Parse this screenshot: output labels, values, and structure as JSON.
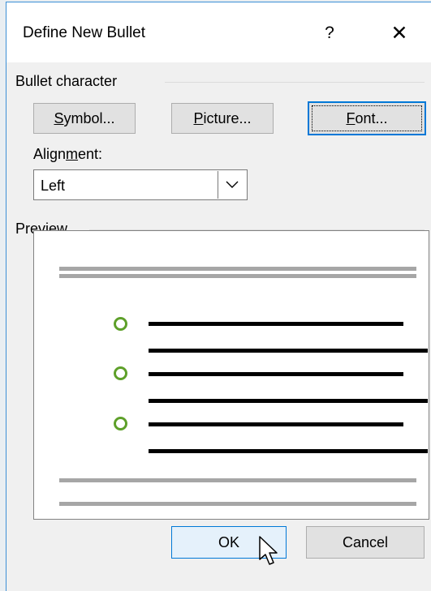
{
  "dialog": {
    "title": "Define New Bullet",
    "help_label": "?",
    "close_label": "✕"
  },
  "bullet_character": {
    "section_label": "Bullet character",
    "symbol_button": {
      "pre": "",
      "accel": "S",
      "post": "ymbol..."
    },
    "picture_button": {
      "pre": "",
      "accel": "P",
      "post": "icture..."
    },
    "font_button": {
      "pre": "",
      "accel": "F",
      "post": "ont..."
    }
  },
  "alignment": {
    "label_pre": "Align",
    "label_accel": "m",
    "label_post": "ent:",
    "selected": "Left"
  },
  "preview": {
    "section_label": "Preview",
    "bullet_color": "#5ea02a"
  },
  "footer": {
    "ok_label": "OK",
    "cancel_label": "Cancel"
  },
  "colors": {
    "accent": "#0078d7",
    "dialog_bg": "#f0f0f0"
  }
}
